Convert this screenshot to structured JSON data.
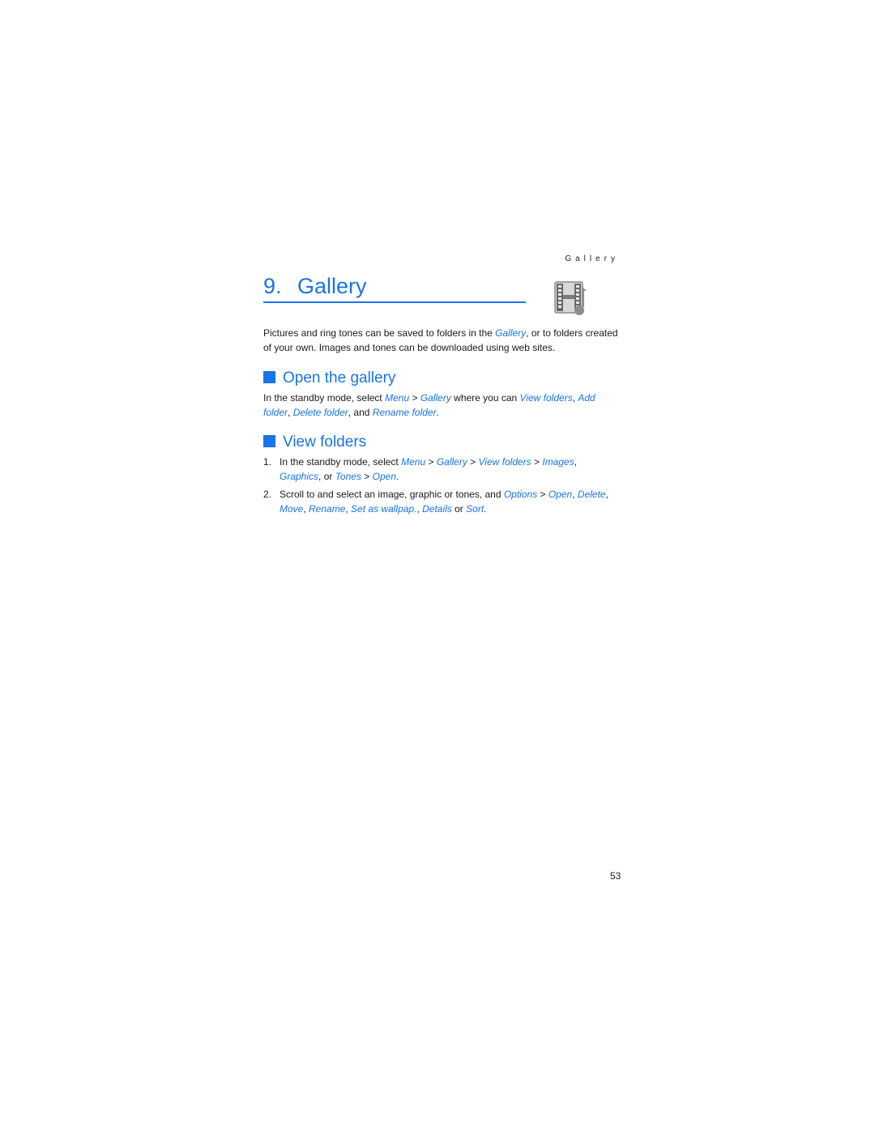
{
  "running_header": "Gallery",
  "chapter": {
    "number": "9.",
    "title": "Gallery",
    "icon": "gallery-film-icon"
  },
  "intro": {
    "t1": "Pictures and ring tones can be saved to folders in the ",
    "link1": "Gallery",
    "t2": ", or to folders created of your own. Images and tones can be downloaded using web sites."
  },
  "sections": [
    {
      "title": "Open the gallery",
      "body": {
        "t1": "In the standby mode, select ",
        "l1": "Menu",
        "t2": " > ",
        "l2": "Gallery",
        "t3": " where you can ",
        "l3": "View folders",
        "t4": ", ",
        "l4": "Add folder",
        "t5": ", ",
        "l5": "Delete folder",
        "t6": ", and ",
        "l6": "Rename folder",
        "t7": "."
      }
    },
    {
      "title": "View folders",
      "steps": [
        {
          "num": "1.",
          "t1": "In the standby mode, select ",
          "l1": "Menu",
          "t2": " > ",
          "l2": "Gallery",
          "t3": " > ",
          "l3": "View folders",
          "t4": " > ",
          "l4": "Images",
          "t5": ", ",
          "l5": "Graphics",
          "t6": ", or ",
          "l6": "Tones",
          "t7": " > ",
          "l7": "Open",
          "t8": "."
        },
        {
          "num": "2.",
          "t1": "Scroll to and select an image, graphic or tones, and ",
          "l1": "Options",
          "t2": " > ",
          "l2": "Open",
          "t3": ", ",
          "l3": "Delete",
          "t4": ", ",
          "l4": "Move",
          "t5": ", ",
          "l5": "Rename",
          "t6": ", ",
          "l6": "Set as wallpap.",
          "t7": ", ",
          "l7": "Details",
          "t8": " or ",
          "l8": "Sort",
          "t9": "."
        }
      ]
    }
  ],
  "page_number": "53",
  "colors": {
    "accent": "#1a73e8",
    "text": "#1a1a1a"
  }
}
